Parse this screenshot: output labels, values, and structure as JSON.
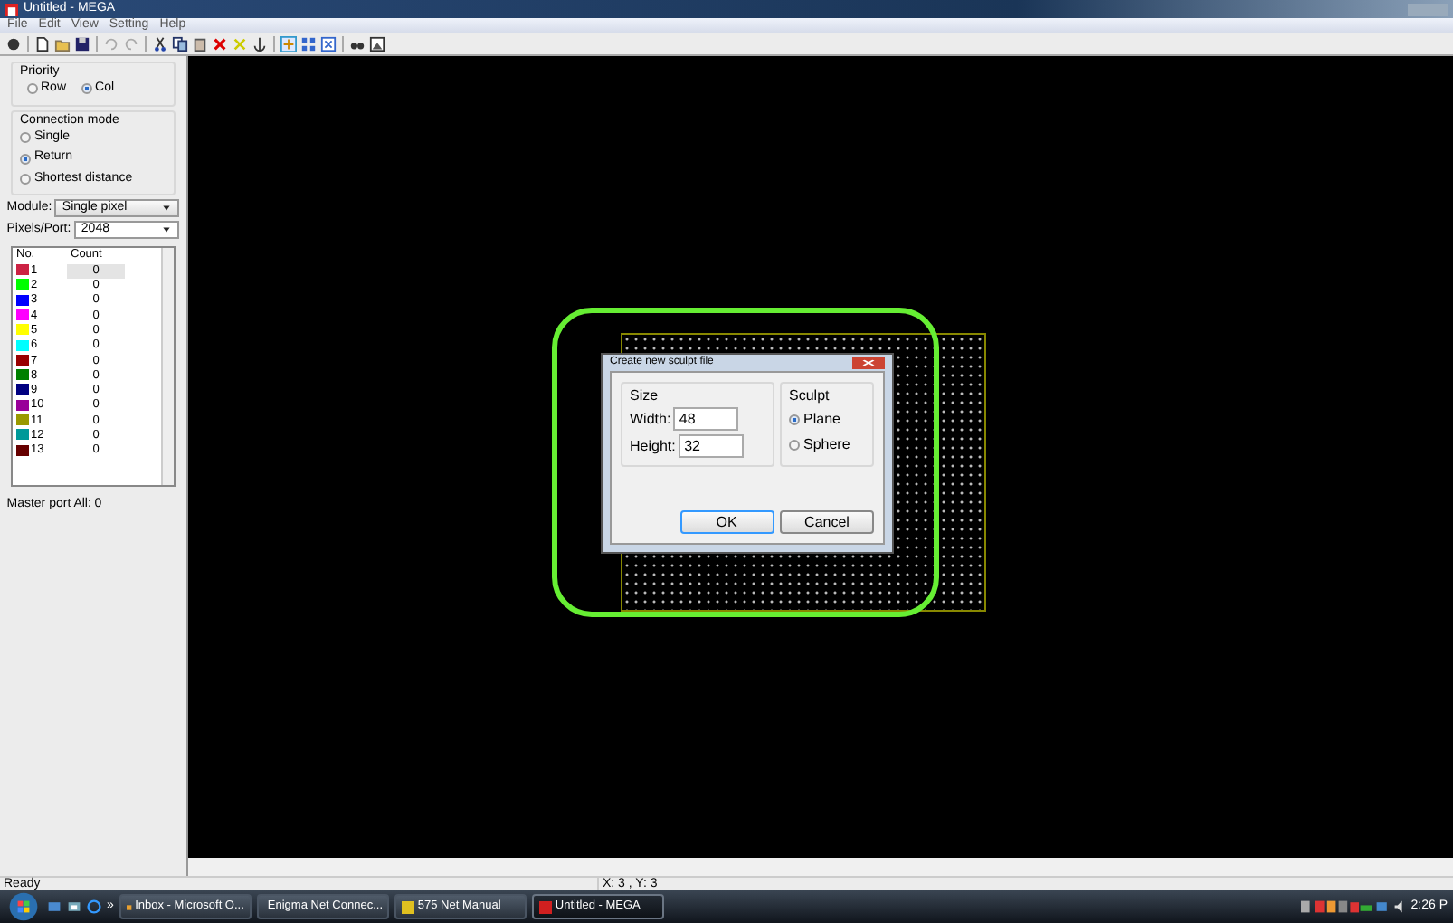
{
  "window": {
    "title": "Untitled - MEGA"
  },
  "menu": [
    "File",
    "Edit",
    "View",
    "Setting",
    "Help"
  ],
  "priority": {
    "label": "Priority",
    "options": [
      {
        "label": "Row",
        "selected": false
      },
      {
        "label": "Col",
        "selected": true
      }
    ]
  },
  "connection_mode": {
    "label": "Connection mode",
    "options": [
      {
        "label": "Single",
        "selected": false
      },
      {
        "label": "Return",
        "selected": true
      },
      {
        "label": "Shortest distance",
        "selected": false
      }
    ]
  },
  "module": {
    "label": "Module:",
    "value": "Single pixel"
  },
  "pixels_per_port": {
    "label": "Pixels/Port:",
    "value": "2048"
  },
  "port_table": {
    "columns": [
      "No.",
      "Count"
    ],
    "rows": [
      {
        "no": "1",
        "count": "0",
        "color": "#cc2244",
        "selected": true
      },
      {
        "no": "2",
        "count": "0",
        "color": "#00ff00",
        "selected": false
      },
      {
        "no": "3",
        "count": "0",
        "color": "#0000ff",
        "selected": false
      },
      {
        "no": "4",
        "count": "0",
        "color": "#ff00ff",
        "selected": false
      },
      {
        "no": "5",
        "count": "0",
        "color": "#ffff00",
        "selected": false
      },
      {
        "no": "6",
        "count": "0",
        "color": "#00ffff",
        "selected": false
      },
      {
        "no": "7",
        "count": "0",
        "color": "#990000",
        "selected": false
      },
      {
        "no": "8",
        "count": "0",
        "color": "#008000",
        "selected": false
      },
      {
        "no": "9",
        "count": "0",
        "color": "#000080",
        "selected": false
      },
      {
        "no": "10",
        "count": "0",
        "color": "#990099",
        "selected": false
      },
      {
        "no": "11",
        "count": "0",
        "color": "#999900",
        "selected": false
      },
      {
        "no": "12",
        "count": "0",
        "color": "#009999",
        "selected": false
      },
      {
        "no": "13",
        "count": "0",
        "color": "#660000",
        "selected": false
      }
    ]
  },
  "master_port": {
    "label": "Master port All:",
    "value": "0"
  },
  "dialog": {
    "title": "Create new sculpt file",
    "size_label": "Size",
    "width_label": "Width:",
    "width_value": "48",
    "height_label": "Height:",
    "height_value": "32",
    "sculpt_label": "Sculpt",
    "sculpt_options": [
      {
        "label": "Plane",
        "selected": true
      },
      {
        "label": "Sphere",
        "selected": false
      }
    ],
    "buttons": [
      "OK",
      "Cancel"
    ]
  },
  "status_bar": {
    "text": "Ready",
    "coords": "X: 3 , Y: 3"
  },
  "taskbar": {
    "overflow": "»",
    "buttons": [
      {
        "label": "Inbox - Microsoft O...",
        "selected": false
      },
      {
        "label": "Enigma Net Connec...",
        "selected": false
      },
      {
        "label": "575 Net Manual",
        "selected": false
      },
      {
        "label": "Untitled - MEGA",
        "selected": true
      }
    ],
    "clock": "2:26 P"
  }
}
